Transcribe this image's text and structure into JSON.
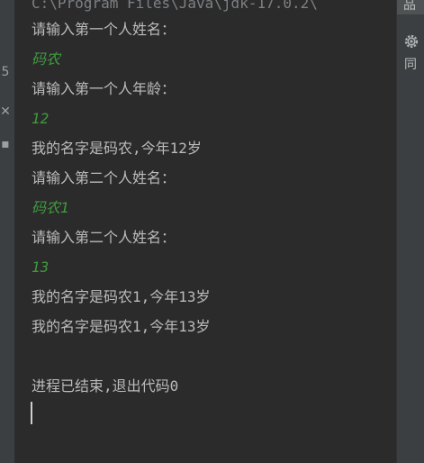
{
  "gutter": {
    "marks": [
      "5",
      "✕",
      "▪"
    ]
  },
  "console": {
    "cut_line": "C:\\Program Files\\Java\\jdk-17.0.2\\",
    "lines": [
      {
        "text": "请输入第一个人姓名：",
        "kind": "output"
      },
      {
        "text": "码农",
        "kind": "input"
      },
      {
        "text": "请输入第一个人年龄：",
        "kind": "output"
      },
      {
        "text": "12",
        "kind": "input"
      },
      {
        "text": "我的名字是码农,今年12岁",
        "kind": "output"
      },
      {
        "text": "请输入第二个人姓名：",
        "kind": "output"
      },
      {
        "text": "码农1",
        "kind": "input"
      },
      {
        "text": "请输入第二个人姓名：",
        "kind": "output"
      },
      {
        "text": "13",
        "kind": "input"
      },
      {
        "text": "我的名字是码农1,今年13岁",
        "kind": "output"
      },
      {
        "text": "我的名字是码农1,今年13岁",
        "kind": "output"
      },
      {
        "text": "",
        "kind": "output"
      },
      {
        "text": "进程已结束,退出代码0",
        "kind": "output"
      }
    ]
  },
  "right_bar": {
    "top_tab": "品",
    "settings_icon": "gear-icon",
    "side_label": "同"
  },
  "colors": {
    "background": "#2b2b2b",
    "output_text": "#bbbbbb",
    "input_text": "#3f9a3f",
    "panel": "#3c3f41"
  }
}
